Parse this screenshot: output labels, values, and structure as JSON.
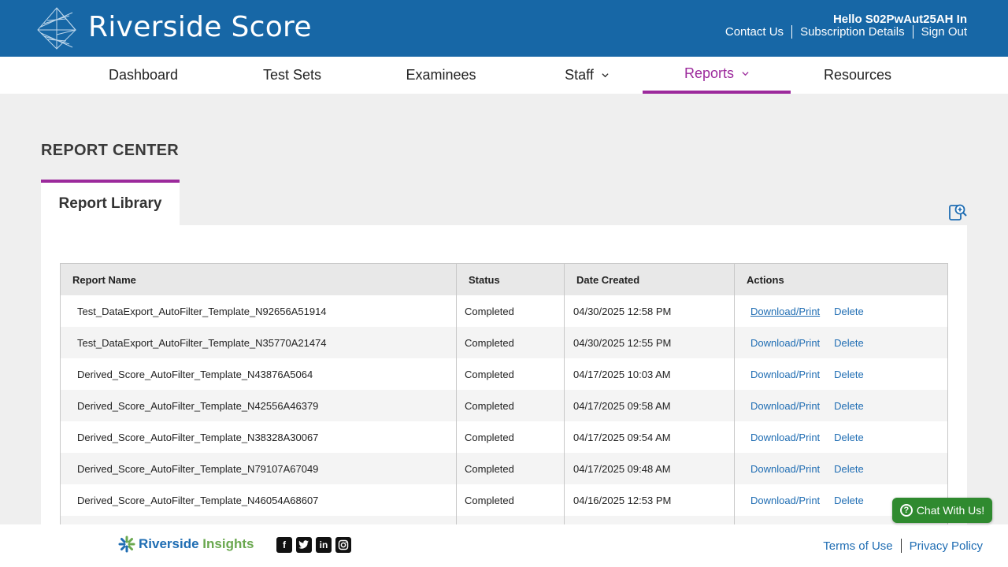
{
  "header": {
    "brand": "Riverside Score",
    "greeting": "Hello S02PwAut25AH In",
    "links": {
      "contact": "Contact Us",
      "subscription": "Subscription Details",
      "signout": "Sign Out"
    },
    "bg_color": "#1767a6"
  },
  "nav": {
    "items": [
      {
        "label": "Dashboard"
      },
      {
        "label": "Test Sets"
      },
      {
        "label": "Examinees"
      },
      {
        "label": "Staff"
      },
      {
        "label": "Reports"
      },
      {
        "label": "Resources"
      }
    ],
    "active_color": "#9c2a9c"
  },
  "main": {
    "title": "REPORT CENTER",
    "tab": "Report Library",
    "table": {
      "headers": [
        "Report Name",
        "Status",
        "Date Created",
        "Actions"
      ],
      "rows": [
        {
          "name": "Test_DataExport_AutoFilter_Template_N92656A51914",
          "status": "Completed",
          "date": "04/30/2025 12:58 PM",
          "download": "Download/Print",
          "delete": "Delete"
        },
        {
          "name": "Test_DataExport_AutoFilter_Template_N35770A21474",
          "status": "Completed",
          "date": "04/30/2025 12:55 PM",
          "download": "Download/Print",
          "delete": "Delete"
        },
        {
          "name": "Derived_Score_AutoFilter_Template_N43876A5064",
          "status": "Completed",
          "date": "04/17/2025 10:03 AM",
          "download": "Download/Print",
          "delete": "Delete"
        },
        {
          "name": "Derived_Score_AutoFilter_Template_N42556A46379",
          "status": "Completed",
          "date": "04/17/2025 09:58 AM",
          "download": "Download/Print",
          "delete": "Delete"
        },
        {
          "name": "Derived_Score_AutoFilter_Template_N38328A30067",
          "status": "Completed",
          "date": "04/17/2025 09:54 AM",
          "download": "Download/Print",
          "delete": "Delete"
        },
        {
          "name": "Derived_Score_AutoFilter_Template_N79107A67049",
          "status": "Completed",
          "date": "04/17/2025 09:48 AM",
          "download": "Download/Print",
          "delete": "Delete"
        },
        {
          "name": "Derived_Score_AutoFilter_Template_N46054A68607",
          "status": "Completed",
          "date": "04/16/2025 12:53 PM",
          "download": "Download/Print",
          "delete": "Delete"
        }
      ]
    }
  },
  "footer": {
    "logo_a": "Riverside",
    "logo_b": "Insights",
    "social": [
      "facebook-icon",
      "twitter-icon",
      "linkedin-icon",
      "instagram-icon"
    ],
    "terms": "Terms of Use",
    "privacy": "Privacy Policy",
    "chat": "Chat With Us!"
  }
}
